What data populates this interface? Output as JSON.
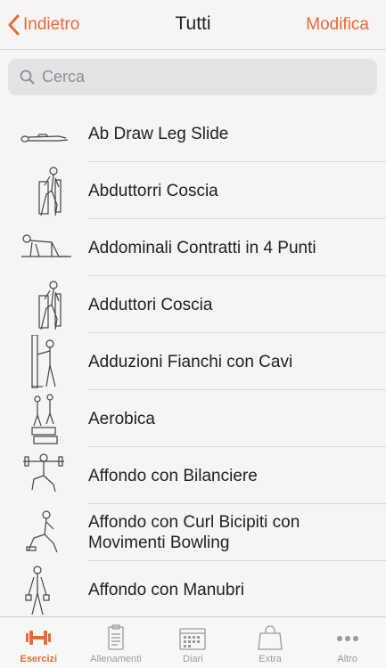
{
  "nav": {
    "back_label": "Indietro",
    "title": "Tutti",
    "edit_label": "Modifica"
  },
  "search": {
    "placeholder": "Cerca"
  },
  "exercises": [
    "Ab Draw Leg Slide",
    "Abduttorri Coscia",
    "Addominali Contratti in 4 Punti",
    "Adduttori Coscia",
    "Adduzioni Fianchi con Cavi",
    "Aerobica",
    "Affondo con Bilanciere",
    "Affondo con Curl Bicipiti con Movimenti Bowling",
    "Affondo con Manubri"
  ],
  "tabs": [
    {
      "label": "Esercizi",
      "icon": "dumbbell-icon",
      "active": true
    },
    {
      "label": "Allenamenti",
      "icon": "clipboard-icon",
      "active": false
    },
    {
      "label": "Diari",
      "icon": "calendar-icon",
      "active": false
    },
    {
      "label": "Extra",
      "icon": "shopping-bag-icon",
      "active": false
    },
    {
      "label": "Altro",
      "icon": "more-dots-icon",
      "active": false
    }
  ],
  "colors": {
    "accent": "#ea6a3c",
    "inactive": "#9a9a9a",
    "background": "#f5f5f5"
  }
}
